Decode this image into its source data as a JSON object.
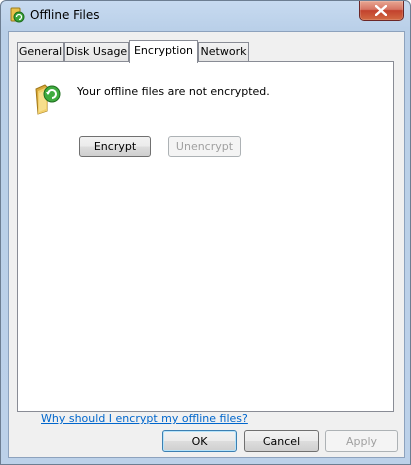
{
  "window": {
    "title": "Offline Files"
  },
  "tabs": [
    {
      "label": "General"
    },
    {
      "label": "Disk Usage"
    },
    {
      "label": "Encryption"
    },
    {
      "label": "Network"
    }
  ],
  "encryption": {
    "status_message": "Your offline files are not encrypted.",
    "encrypt_label": "Encrypt",
    "unencrypt_label": "Unencrypt",
    "help_link": "Why should I encrypt my offline files?"
  },
  "footer": {
    "ok_label": "OK",
    "cancel_label": "Cancel",
    "apply_label": "Apply"
  },
  "icons": {
    "title": "offline-files-icon",
    "close": "close-icon",
    "folder": "sync-folder-icon"
  },
  "colors": {
    "link": "#0066cc",
    "close_button": "#c2412d",
    "titlebar": "#b9cfe8"
  }
}
